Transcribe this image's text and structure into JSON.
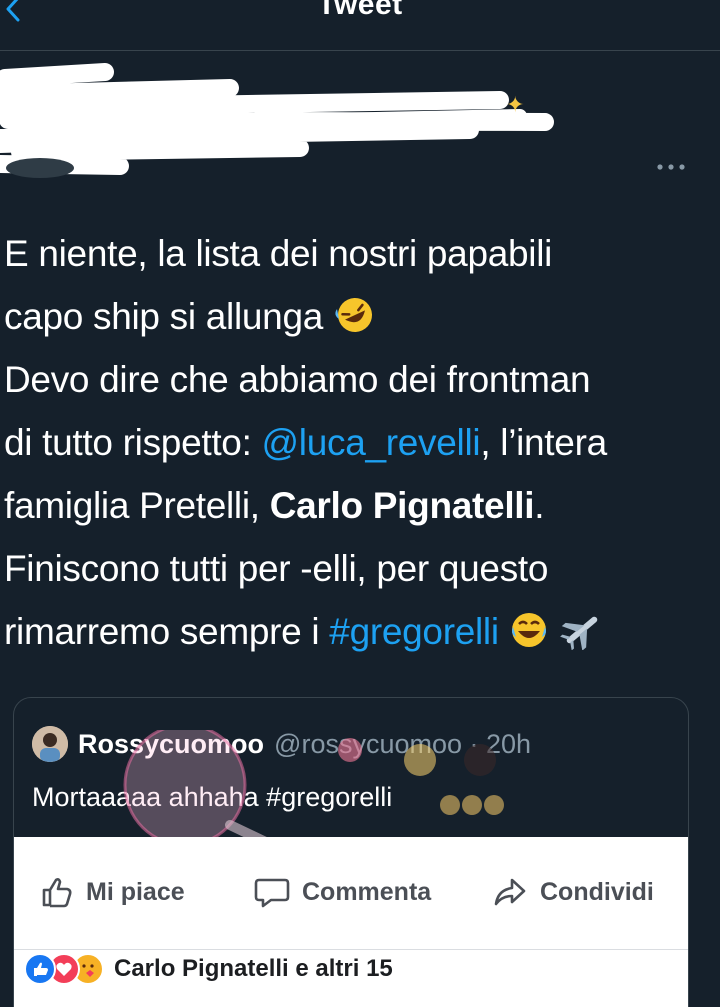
{
  "topbar": {
    "title": "Tweet"
  },
  "icons": {
    "back": "chevron-left-icon",
    "more": "more-horizontal-icon"
  },
  "tweet": {
    "lines": {
      "l1": "E niente, la lista dei nostri papabili",
      "l2": "capo ship si allunga",
      "l3": "Devo dire che abbiamo dei frontman",
      "l4_a": "di tutto rispetto: ",
      "l4_mention": "@luca_revelli",
      "l4_b": ", l’intera",
      "l5_a": "famiglia Pretelli, ",
      "l5_bold": "Carlo Pignatelli",
      "l5_b": ".",
      "l6": "Finiscono tutti per -elli, per questo",
      "l7_a": "rimarremo sempre i ",
      "l7_hashtag": "#gregorelli"
    },
    "emojis": [
      "rolling-on-floor-laughing",
      "tears-of-joy",
      "airplane"
    ]
  },
  "quote": {
    "name": "Rossycuomoo",
    "handle_time": "@rossycuomoo · 20h",
    "text": "Mortaaaaa ahhaha #gregorelli"
  },
  "facebook": {
    "like": "Mi piace",
    "comment": "Commenta",
    "share": "Condividi",
    "reactions_text": "Carlo Pignatelli e altri 15"
  },
  "colors": {
    "background": "#15202b",
    "link": "#1da1f2",
    "border": "#38444d",
    "fb_blue": "#1877f2"
  }
}
